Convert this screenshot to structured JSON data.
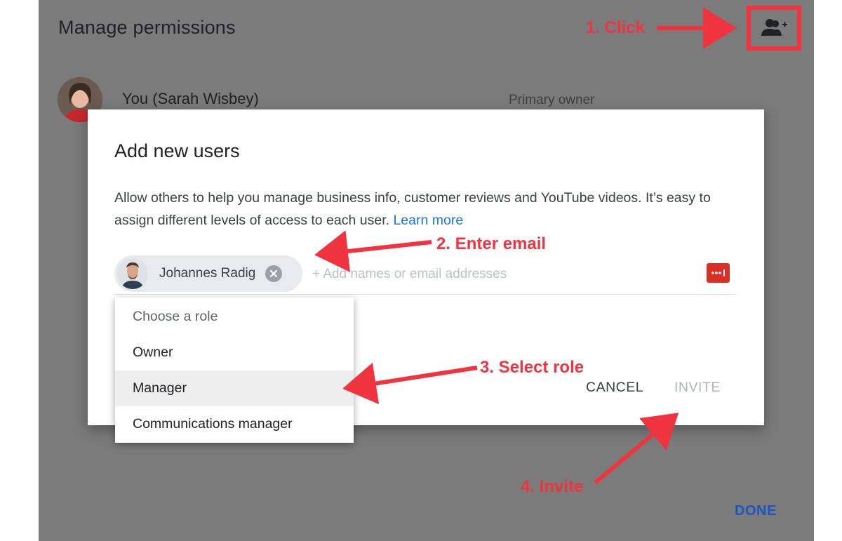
{
  "page": {
    "title": "Manage permissions",
    "owner_name": "You (Sarah Wisbey)",
    "owner_role": "Primary owner",
    "done_label": "DONE"
  },
  "dialog": {
    "title": "Add new users",
    "description": "Allow others to help you manage business info, customer reviews and YouTube videos. It’s easy to assign different levels of access to each user.",
    "learn_more": "Learn more",
    "chip_name": "Johannes Radig",
    "input_placeholder": "+ Add names or email addresses",
    "cancel_label": "CANCEL",
    "invite_label": "INVITE"
  },
  "role_menu": {
    "header": "Choose a role",
    "options": [
      "Owner",
      "Manager",
      "Communications manager"
    ],
    "selected": "Manager"
  },
  "annotations": {
    "step1": "1. Click",
    "step2": "2. Enter email",
    "step3": "3. Select role",
    "step4": "4. Invite"
  },
  "colors": {
    "annotation": "#f0343f",
    "overlay": "#7b7b7b",
    "link": "#1a73e8",
    "done": "#1a56c4"
  },
  "icons": {
    "add_user": "person-add-icon",
    "remove_chip": "close-circle-icon",
    "password_manager": "password-manager-icon"
  }
}
